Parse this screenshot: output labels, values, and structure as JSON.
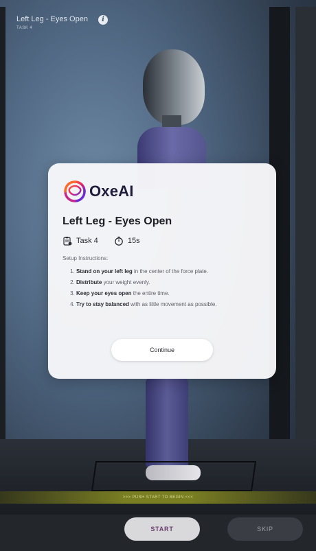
{
  "header": {
    "title": "Left Leg - Eyes Open",
    "subtitle": "TASK 4",
    "info_icon": "info-icon"
  },
  "modal": {
    "brand": "OxeAI",
    "title": "Left Leg - Eyes Open",
    "task_label": "Task 4",
    "duration_label": "15s",
    "setup_heading": "Setup Instructions:",
    "instructions": [
      {
        "bold": "Stand on your left leg",
        "rest": " in the center of the force plate."
      },
      {
        "bold": "Distribute",
        "rest": " your weight evenly."
      },
      {
        "bold": "Keep your eyes open",
        "rest": " the entire time."
      },
      {
        "bold": "Try to stay balanced",
        "rest": " with as little movement as possible."
      }
    ],
    "continue_label": "Continue"
  },
  "prompt_bar": {
    "text": ">>> PUSH START TO BEGIN <<<"
  },
  "footer": {
    "start_label": "START",
    "skip_label": "SKIP"
  },
  "colors": {
    "accent_start_text": "#6a3b6e",
    "push_bar": "#8b8f22"
  }
}
